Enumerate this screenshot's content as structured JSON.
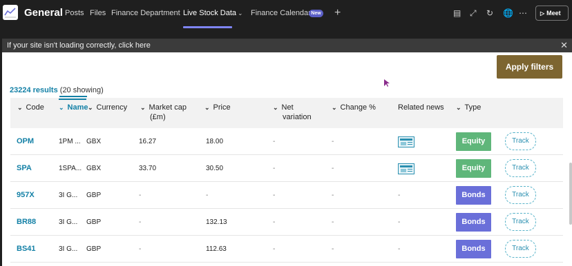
{
  "header": {
    "channel": "General",
    "tabs": [
      {
        "label": "Posts"
      },
      {
        "label": "Files"
      },
      {
        "label": "Finance Department"
      },
      {
        "label": "Live Stock Data"
      },
      {
        "label": "Finance Calendar",
        "badge": "New"
      }
    ],
    "meet_label": "Meet"
  },
  "banner": {
    "text": "If your site isn't loading correctly, click here"
  },
  "filters": {
    "apply_label": "Apply filters"
  },
  "results": {
    "count": "23224 results",
    "showing": "(20 showing)"
  },
  "table": {
    "columns": [
      {
        "label": "Code"
      },
      {
        "label": "Name"
      },
      {
        "label": "Currency"
      },
      {
        "label": "Market cap",
        "sub": "(£m)"
      },
      {
        "label": "Price"
      },
      {
        "label": "Net",
        "sub": "variation"
      },
      {
        "label": "Change %"
      },
      {
        "label": "Related news"
      },
      {
        "label": "Type"
      }
    ],
    "rows": [
      {
        "code": "OPM",
        "name": "1PM ...",
        "currency": "GBX",
        "market_cap": "16.27",
        "price": "18.00",
        "net_variation": "-",
        "change": "-",
        "news": true,
        "type": "Equity",
        "track": "Track"
      },
      {
        "code": "SPA",
        "name": "1SPA...",
        "currency": "GBX",
        "market_cap": "33.70",
        "price": "30.50",
        "net_variation": "-",
        "change": "-",
        "news": true,
        "type": "Equity",
        "track": "Track"
      },
      {
        "code": "957X",
        "name": "3I G...",
        "currency": "GBP",
        "market_cap": "-",
        "price": "-",
        "net_variation": "-",
        "change": "-",
        "news": false,
        "news_text": "-",
        "type": "Bonds",
        "track": "Track"
      },
      {
        "code": "BR88",
        "name": "3I G...",
        "currency": "GBP",
        "market_cap": "-",
        "price": "132.13",
        "net_variation": "-",
        "change": "-",
        "news": false,
        "news_text": "-",
        "type": "Bonds",
        "track": "Track"
      },
      {
        "code": "BS41",
        "name": "3I G...",
        "currency": "GBP",
        "market_cap": "-",
        "price": "112.63",
        "net_variation": "-",
        "change": "-",
        "news": false,
        "news_text": "-",
        "type": "Bonds",
        "track": "Track"
      }
    ]
  },
  "colors": {
    "equity": "#5fb67a",
    "bonds": "#6a6fd9",
    "accent": "#1380a6",
    "apply": "#7d6530"
  }
}
